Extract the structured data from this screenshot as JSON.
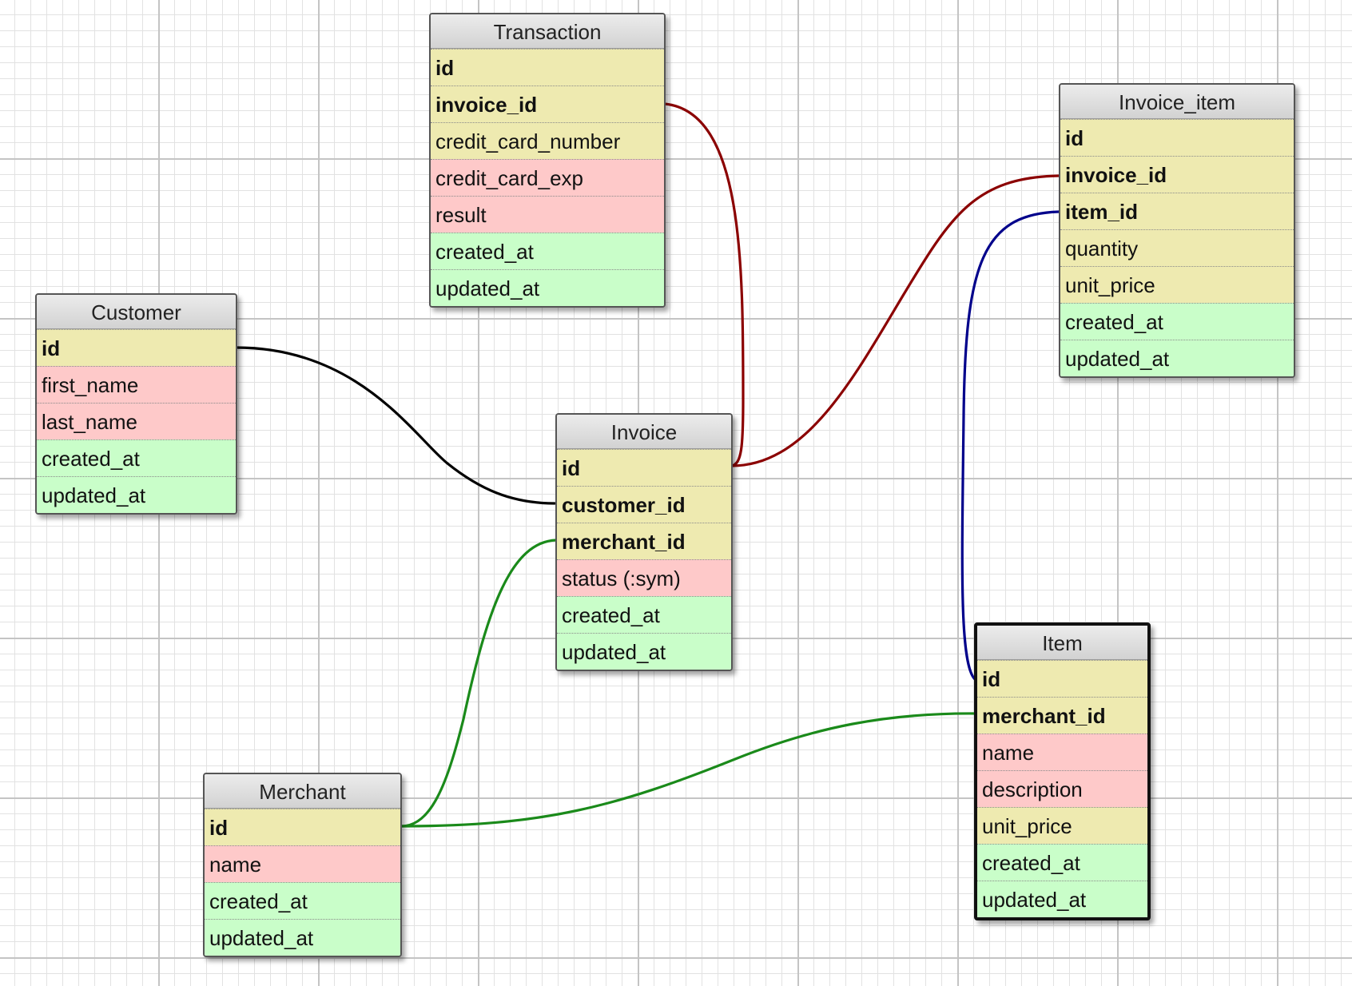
{
  "diagram": {
    "tables": [
      {
        "id": "transaction",
        "name": "Transaction",
        "fields": [
          {
            "name": "id",
            "key": true,
            "color": "#eeeab0"
          },
          {
            "name": "invoice_id",
            "key": true,
            "color": "#eeeab0"
          },
          {
            "name": "credit_card_number",
            "key": false,
            "color": "#eeeab0"
          },
          {
            "name": "credit_card_exp",
            "key": false,
            "color": "#fec9c9"
          },
          {
            "name": "result",
            "key": false,
            "color": "#fec9c9"
          },
          {
            "name": "created_at",
            "key": false,
            "color": "#c9fec9"
          },
          {
            "name": "updated_at",
            "key": false,
            "color": "#c9fec9"
          }
        ]
      },
      {
        "id": "customer",
        "name": "Customer",
        "fields": [
          {
            "name": "id",
            "key": true,
            "color": "#eeeab0"
          },
          {
            "name": "first_name",
            "key": false,
            "color": "#fec9c9"
          },
          {
            "name": "last_name",
            "key": false,
            "color": "#fec9c9"
          },
          {
            "name": "created_at",
            "key": false,
            "color": "#c9fec9"
          },
          {
            "name": "updated_at",
            "key": false,
            "color": "#c9fec9"
          }
        ]
      },
      {
        "id": "invoice",
        "name": "Invoice",
        "fields": [
          {
            "name": "id",
            "key": true,
            "color": "#eeeab0"
          },
          {
            "name": "customer_id",
            "key": true,
            "color": "#eeeab0"
          },
          {
            "name": "merchant_id",
            "key": true,
            "color": "#eeeab0"
          },
          {
            "name": "status (:sym)",
            "key": false,
            "color": "#fec9c9"
          },
          {
            "name": "created_at",
            "key": false,
            "color": "#c9fec9"
          },
          {
            "name": "updated_at",
            "key": false,
            "color": "#c9fec9"
          }
        ]
      },
      {
        "id": "invoice_item",
        "name": "Invoice_item",
        "fields": [
          {
            "name": "id",
            "key": true,
            "color": "#eeeab0"
          },
          {
            "name": "invoice_id",
            "key": true,
            "color": "#eeeab0"
          },
          {
            "name": "item_id",
            "key": true,
            "color": "#eeeab0"
          },
          {
            "name": "quantity",
            "key": false,
            "color": "#eeeab0"
          },
          {
            "name": "unit_price",
            "key": false,
            "color": "#eeeab0"
          },
          {
            "name": "created_at",
            "key": false,
            "color": "#c9fec9"
          },
          {
            "name": "updated_at",
            "key": false,
            "color": "#c9fec9"
          }
        ]
      },
      {
        "id": "merchant",
        "name": "Merchant",
        "fields": [
          {
            "name": "id",
            "key": true,
            "color": "#eeeab0"
          },
          {
            "name": "name",
            "key": false,
            "color": "#fec9c9"
          },
          {
            "name": "created_at",
            "key": false,
            "color": "#c9fec9"
          },
          {
            "name": "updated_at",
            "key": false,
            "color": "#c9fec9"
          }
        ]
      },
      {
        "id": "item",
        "name": "Item",
        "selected": true,
        "fields": [
          {
            "name": "id",
            "key": true,
            "color": "#eeeab0"
          },
          {
            "name": "merchant_id",
            "key": true,
            "color": "#eeeab0"
          },
          {
            "name": "name",
            "key": false,
            "color": "#fec9c9"
          },
          {
            "name": "description",
            "key": false,
            "color": "#fec9c9"
          },
          {
            "name": "unit_price",
            "key": false,
            "color": "#eeeab0"
          },
          {
            "name": "created_at",
            "key": false,
            "color": "#c9fec9"
          },
          {
            "name": "updated_at",
            "key": false,
            "color": "#c9fec9"
          }
        ]
      }
    ],
    "relationships": [
      {
        "from": "customer.id",
        "to": "invoice.customer_id",
        "color": "#000000"
      },
      {
        "from": "transaction.invoice_id",
        "to": "invoice.id",
        "color": "#8b0000"
      },
      {
        "from": "invoice.id",
        "to": "invoice_item.invoice_id",
        "color": "#8b0000"
      },
      {
        "from": "item.id",
        "to": "invoice_item.item_id",
        "color": "#00008b"
      },
      {
        "from": "merchant.id",
        "to": "invoice.merchant_id",
        "color": "#1a8a1a"
      },
      {
        "from": "merchant.id",
        "to": "item.merchant_id",
        "color": "#1a8a1a"
      }
    ],
    "legend": {
      "key_color": "#eeeab0",
      "data_color": "#fec9c9",
      "timestamp_color": "#c9fec9"
    }
  }
}
